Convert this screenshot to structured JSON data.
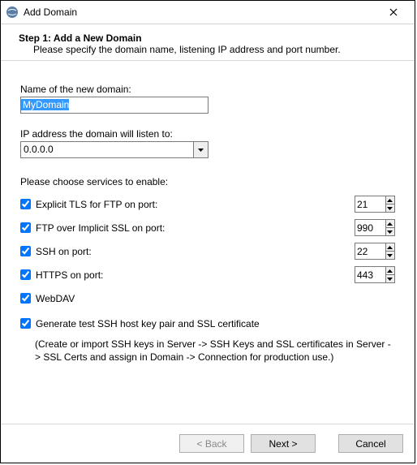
{
  "window": {
    "title": "Add Domain"
  },
  "header": {
    "step_title": "Step 1: Add a New Domain",
    "step_desc": "Please specify the domain name, listening IP address and port number."
  },
  "form": {
    "name_label": "Name of the new domain:",
    "name_value": "MyDomain",
    "ip_label": "IP address the domain will listen to:",
    "ip_value": "0.0.0.0",
    "services_label": "Please choose services to enable:",
    "services": [
      {
        "label": "Explicit TLS for FTP on port:",
        "port": "21",
        "checked": true
      },
      {
        "label": "FTP over Implicit SSL on port:",
        "port": "990",
        "checked": true
      },
      {
        "label": "SSH on port:",
        "port": "22",
        "checked": true
      },
      {
        "label": "HTTPS on port:",
        "port": "443",
        "checked": true
      }
    ],
    "webdav_label": "WebDAV",
    "webdav_checked": true,
    "gen_label": "Generate test SSH host key pair and SSL certificate",
    "gen_checked": true,
    "gen_note": "(Create or import SSH keys in Server -> SSH Keys and SSL certificates in Server -> SSL Certs and assign in Domain -> Connection for production use.)"
  },
  "buttons": {
    "back": "< Back",
    "next": "Next >",
    "cancel": "Cancel"
  }
}
